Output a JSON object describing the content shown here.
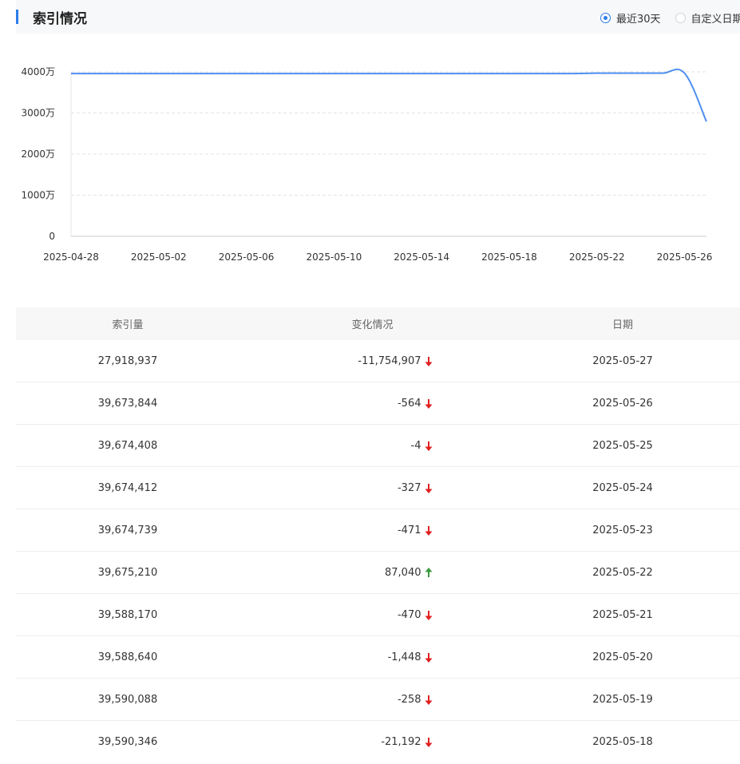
{
  "header": {
    "title": "索引情况",
    "range_options": [
      {
        "label": "最近30天",
        "checked": true
      },
      {
        "label": "自定义日期",
        "checked": false
      }
    ],
    "accent_color": "#2b7de9"
  },
  "chart_data": {
    "type": "line",
    "title": "",
    "xlabel": "",
    "ylabel": "",
    "ylim": [
      0,
      40000000
    ],
    "y_ticks": [
      "0",
      "1000万",
      "2000万",
      "3000万",
      "4000万"
    ],
    "x_ticks": [
      "2025-04-28",
      "2025-05-02",
      "2025-05-06",
      "2025-05-10",
      "2025-05-14",
      "2025-05-18",
      "2025-05-22",
      "2025-05-26"
    ],
    "grid": true,
    "line_color": "#4f8ff0",
    "x": [
      "2025-04-28",
      "2025-04-29",
      "2025-04-30",
      "2025-05-01",
      "2025-05-02",
      "2025-05-03",
      "2025-05-04",
      "2025-05-05",
      "2025-05-06",
      "2025-05-07",
      "2025-05-08",
      "2025-05-09",
      "2025-05-10",
      "2025-05-11",
      "2025-05-12",
      "2025-05-13",
      "2025-05-14",
      "2025-05-15",
      "2025-05-16",
      "2025-05-17",
      "2025-05-18",
      "2025-05-19",
      "2025-05-20",
      "2025-05-21",
      "2025-05-22",
      "2025-05-23",
      "2025-05-24",
      "2025-05-25",
      "2025-05-26",
      "2025-05-27"
    ],
    "values": [
      39590000,
      39590000,
      39590000,
      39590000,
      39590000,
      39590000,
      39590000,
      39590000,
      39590000,
      39590000,
      39590000,
      39590000,
      39590000,
      39590000,
      39590000,
      39590000,
      39590000,
      39590000,
      39590000,
      39590000,
      39590346,
      39590088,
      39588640,
      39588170,
      39675210,
      39674739,
      39674412,
      39674408,
      39673844,
      27918937
    ]
  },
  "table": {
    "columns": [
      "索引量",
      "变化情况",
      "日期"
    ],
    "rows": [
      {
        "index": "27,918,937",
        "change": "-11,754,907",
        "dir": "down",
        "date": "2025-05-27"
      },
      {
        "index": "39,673,844",
        "change": "-564",
        "dir": "down",
        "date": "2025-05-26"
      },
      {
        "index": "39,674,408",
        "change": "-4",
        "dir": "down",
        "date": "2025-05-25"
      },
      {
        "index": "39,674,412",
        "change": "-327",
        "dir": "down",
        "date": "2025-05-24"
      },
      {
        "index": "39,674,739",
        "change": "-471",
        "dir": "down",
        "date": "2025-05-23"
      },
      {
        "index": "39,675,210",
        "change": "87,040",
        "dir": "up",
        "date": "2025-05-22"
      },
      {
        "index": "39,588,170",
        "change": "-470",
        "dir": "down",
        "date": "2025-05-21"
      },
      {
        "index": "39,588,640",
        "change": "-1,448",
        "dir": "down",
        "date": "2025-05-20"
      },
      {
        "index": "39,590,088",
        "change": "-258",
        "dir": "down",
        "date": "2025-05-19"
      },
      {
        "index": "39,590,346",
        "change": "-21,192",
        "dir": "down",
        "date": "2025-05-18"
      }
    ],
    "down_color": "#e02020",
    "up_color": "#3c9a3c"
  }
}
